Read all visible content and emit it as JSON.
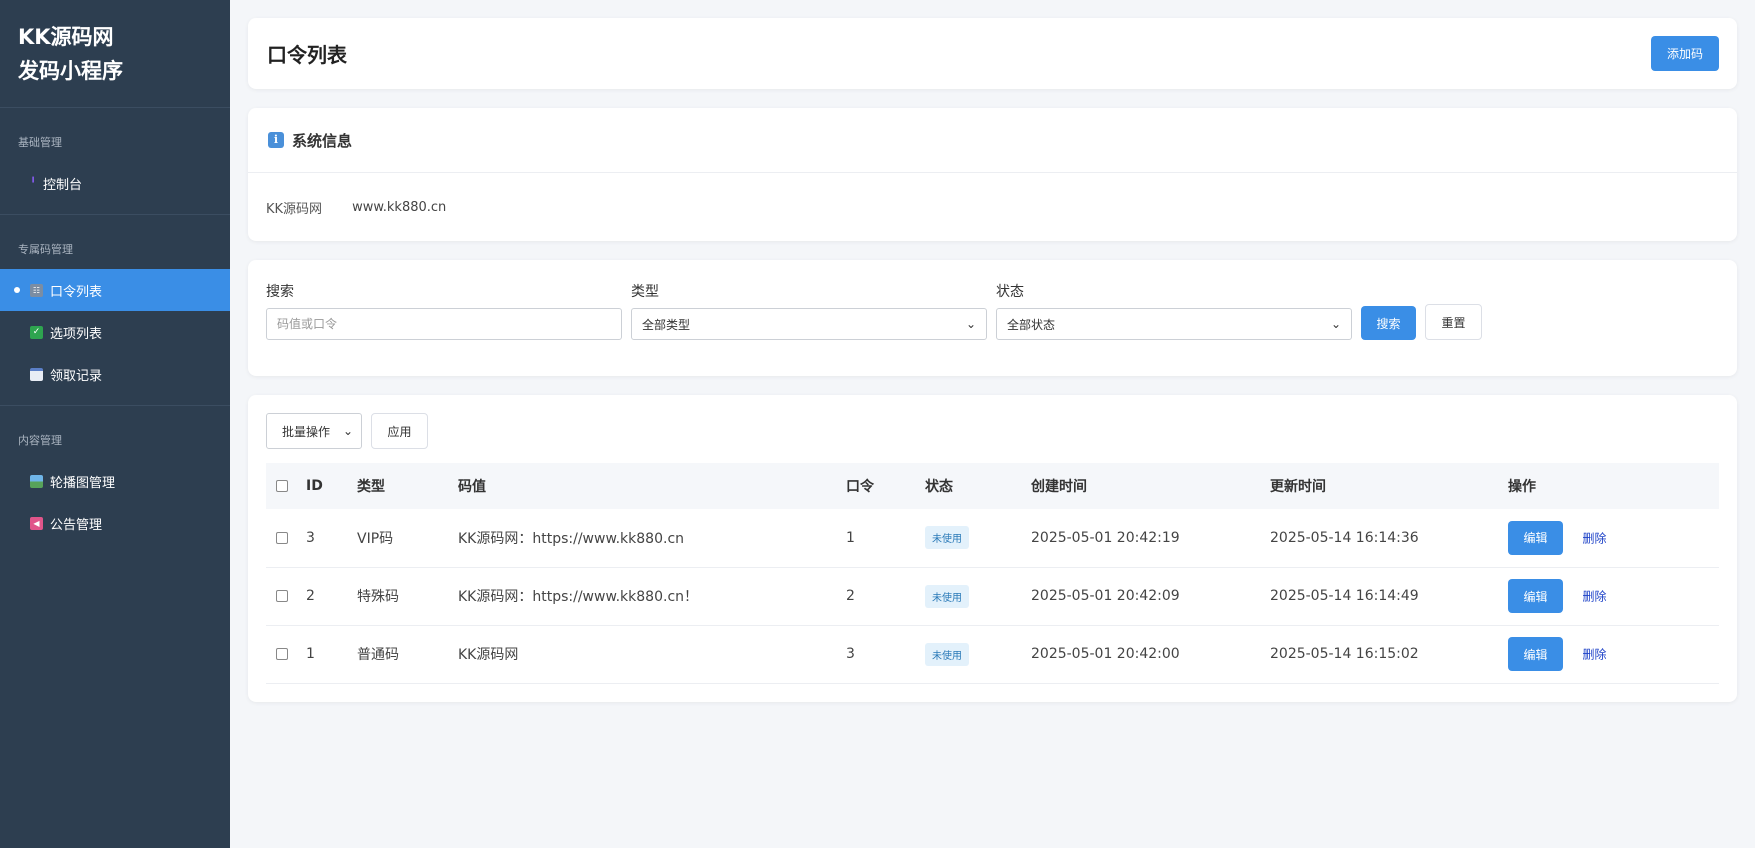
{
  "sidebar": {
    "brand_line1": "KK源码网",
    "brand_line2": "发码小程序",
    "sections": [
      {
        "header": "基础管理",
        "items": [
          {
            "label": "控制台",
            "icon": "dashboard-icon"
          }
        ]
      },
      {
        "header": "专属码管理",
        "items": [
          {
            "label": "口令列表",
            "icon": "list-icon",
            "active": true
          },
          {
            "label": "选项列表",
            "icon": "checkbox-icon"
          },
          {
            "label": "领取记录",
            "icon": "calendar-icon"
          }
        ]
      },
      {
        "header": "内容管理",
        "items": [
          {
            "label": "轮播图管理",
            "icon": "image-icon"
          },
          {
            "label": "公告管理",
            "icon": "megaphone-icon"
          }
        ]
      }
    ]
  },
  "header": {
    "title": "口令列表",
    "add_label": "添加码"
  },
  "system_info": {
    "title": "系统信息",
    "key": "KK源码网",
    "value": "www.kk880.cn"
  },
  "filters": {
    "search_label": "搜索",
    "search_placeholder": "码值或口令",
    "type_label": "类型",
    "type_value": "全部类型",
    "status_label": "状态",
    "status_value": "全部状态",
    "search_button": "搜索",
    "reset_button": "重置"
  },
  "bulk": {
    "select_value": "批量操作",
    "apply_label": "应用"
  },
  "table": {
    "columns": [
      "ID",
      "类型",
      "码值",
      "口令",
      "状态",
      "创建时间",
      "更新时间",
      "操作"
    ],
    "edit_label": "编辑",
    "delete_label": "删除",
    "rows": [
      {
        "id": "3",
        "type": "VIP码",
        "code": "KK源码网：https://www.kk880.cn",
        "token": "1",
        "status": "未使用",
        "created": "2025-05-01 20:42:19",
        "updated": "2025-05-14 16:14:36"
      },
      {
        "id": "2",
        "type": "特殊码",
        "code": "KK源码网：https://www.kk880.cn！",
        "token": "2",
        "status": "未使用",
        "created": "2025-05-01 20:42:09",
        "updated": "2025-05-14 16:14:49"
      },
      {
        "id": "1",
        "type": "普通码",
        "code": "KK源码网",
        "token": "3",
        "status": "未使用",
        "created": "2025-05-01 20:42:00",
        "updated": "2025-05-14 16:15:02"
      }
    ]
  },
  "colors": {
    "sidebar_bg": "#2d3e50",
    "accent": "#3a8ee6",
    "badge_bg": "#e3f1fb",
    "link": "#1a3fc7"
  }
}
